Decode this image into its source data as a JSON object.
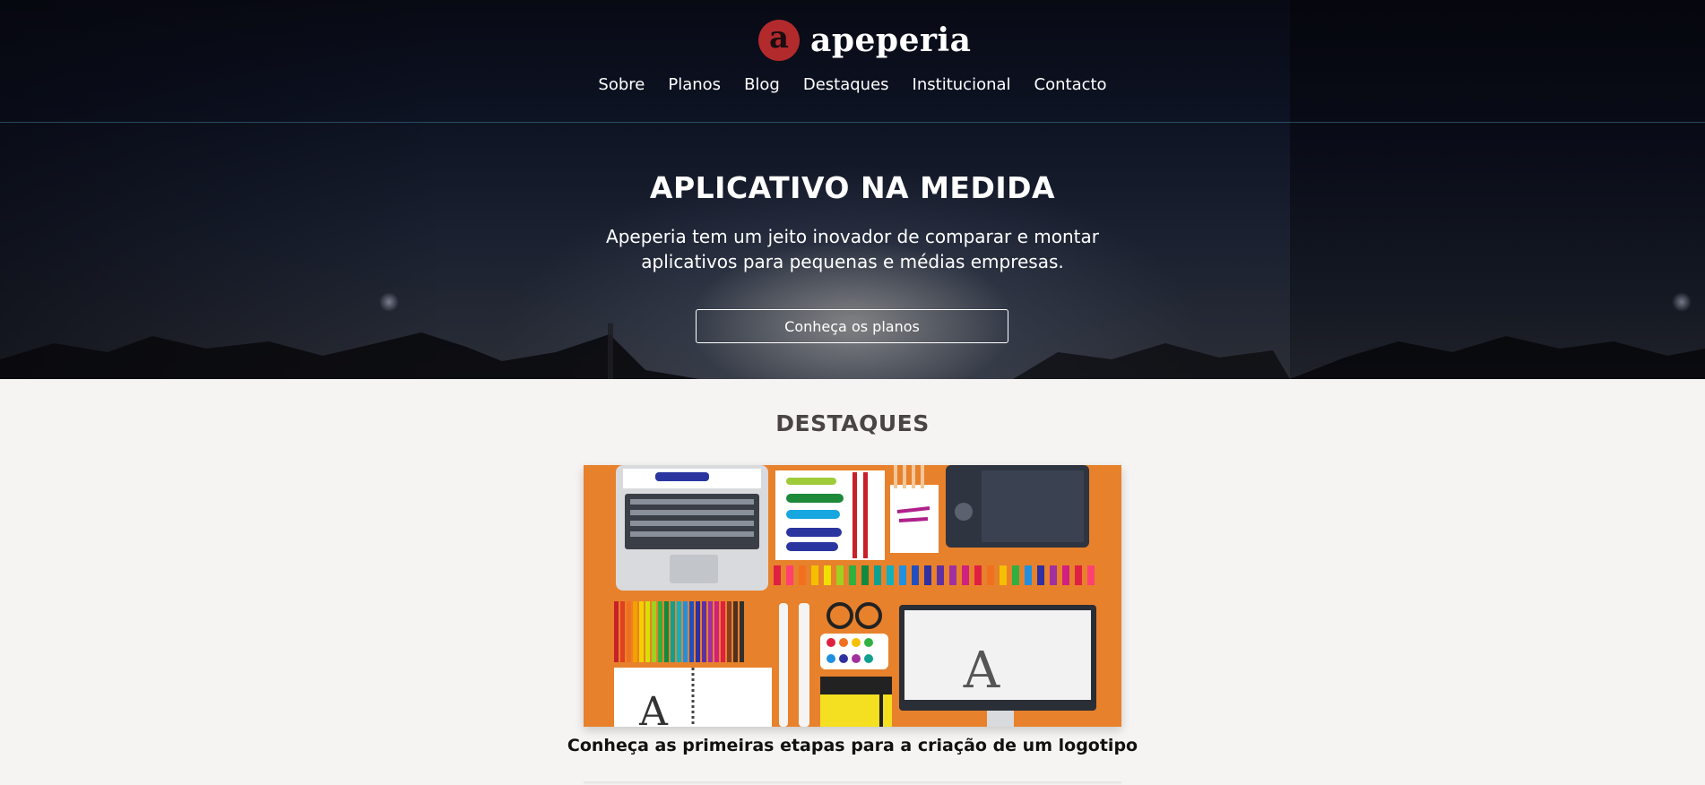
{
  "brand": {
    "logo_letter": "a",
    "name": "apeperia",
    "logo_color": "#b32a2d"
  },
  "nav": {
    "items": [
      {
        "label": "Sobre"
      },
      {
        "label": "Planos"
      },
      {
        "label": "Blog"
      },
      {
        "label": "Destaques"
      },
      {
        "label": "Institucional"
      },
      {
        "label": "Contacto"
      }
    ]
  },
  "hero": {
    "title": "APLICATIVO NA MEDIDA",
    "subtitle": "Apeperia tem um jeito inovador de comparar e montar aplicativos para pequenas e médias empresas.",
    "cta_label": "Conheça os planos"
  },
  "highlights": {
    "title": "DESTAQUES",
    "featured": {
      "image_icon": "design-tools-illustration",
      "image_color": "#e8812b",
      "caption": "Conheça as primeiras etapas para a criação de um logotipo"
    }
  }
}
